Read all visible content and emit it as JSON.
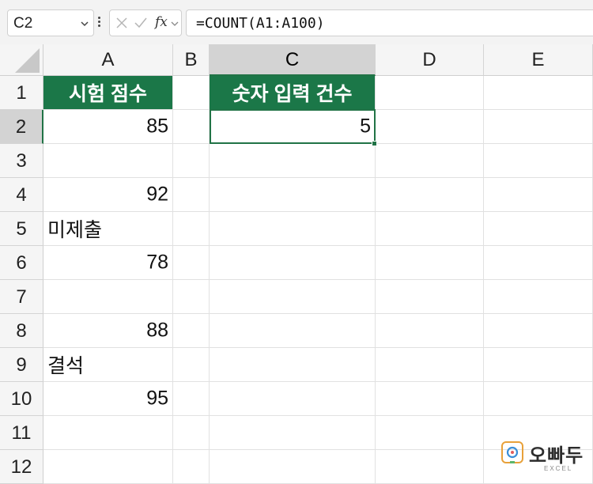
{
  "formula_bar": {
    "name_box": "C2",
    "fx_label": "fx",
    "formula": "=COUNT(A1:A100)"
  },
  "columns": [
    "A",
    "B",
    "C",
    "D",
    "E"
  ],
  "selected_column": "C",
  "rows": [
    "1",
    "2",
    "3",
    "4",
    "5",
    "6",
    "7",
    "8",
    "9",
    "10",
    "11",
    "12"
  ],
  "selected_row": "2",
  "cells": {
    "A1": "시험 점수",
    "A2": "85",
    "A4": "92",
    "A5": "미제출",
    "A6": "78",
    "A8": "88",
    "A9": "결석",
    "A10": "95",
    "C1": "숫자 입력 건수",
    "C2": "5"
  },
  "colors": {
    "header_fill": "#1b7748",
    "selection": "#217346"
  },
  "logo": {
    "text": "오빠두",
    "subtext": "EXCEL"
  }
}
